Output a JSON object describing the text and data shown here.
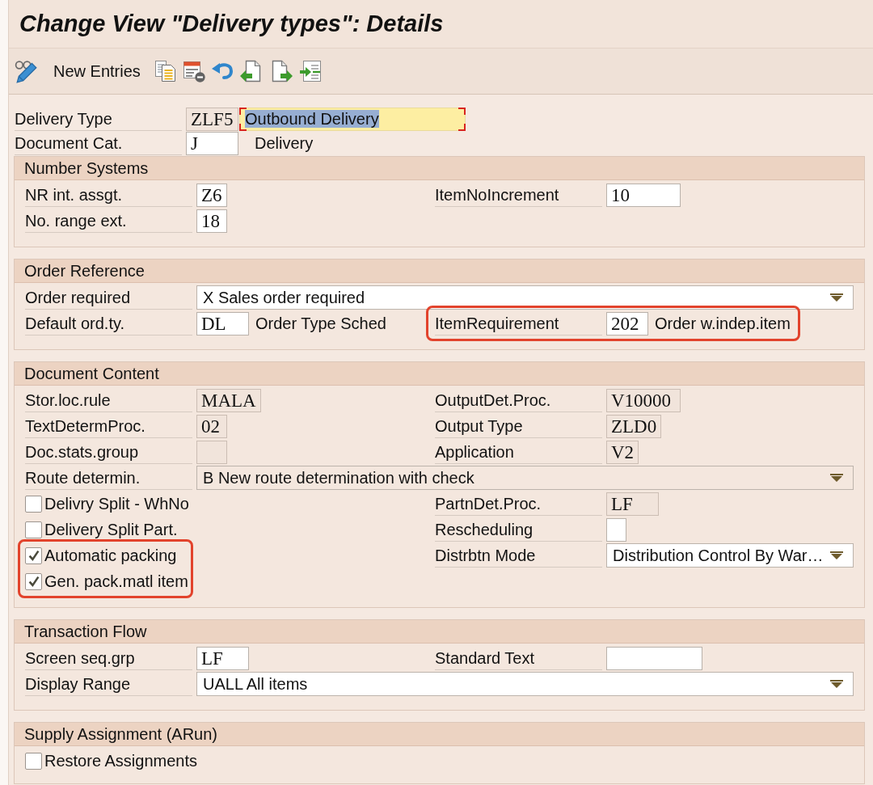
{
  "window": {
    "title": "Change View \"Delivery types\": Details"
  },
  "toolbar": {
    "new_entries": "New Entries"
  },
  "header_fields": [
    {
      "label": "Delivery Type",
      "value": "ZLF5",
      "disabled": true,
      "text_field": {
        "value": "Outbound Delivery",
        "focused": true,
        "text_selected": true
      }
    },
    {
      "label": "Document Cat.",
      "value": "J",
      "disabled": false,
      "description": "Delivery"
    }
  ],
  "sections": [
    {
      "title": "Number Systems",
      "rows": [
        {
          "left": {
            "kind": "field",
            "label": "NR int. assgt.",
            "value": "Z6",
            "disabled": false
          },
          "right": {
            "kind": "field",
            "label": "ItemNoIncrement",
            "value": "10",
            "disabled": false
          }
        },
        {
          "left": {
            "kind": "field",
            "label": "No. range ext.",
            "value": "18",
            "disabled": false
          }
        }
      ]
    },
    {
      "title": "Order Reference",
      "rows": [
        {
          "full": {
            "kind": "dropdown",
            "label": "Order required",
            "value": "X Sales order required",
            "disabled": false
          }
        },
        {
          "left": {
            "kind": "field",
            "label": "Default ord.ty.",
            "value": "DL",
            "disabled": false,
            "description": "Order Type Sched"
          },
          "right": {
            "kind": "field",
            "label": "ItemRequirement",
            "value": "202",
            "disabled": false,
            "description": "Order w.indep.item",
            "highlighted": true
          }
        }
      ]
    },
    {
      "title": "Document Content",
      "rows": [
        {
          "left": {
            "kind": "field",
            "label": "Stor.loc.rule",
            "value": "MALA",
            "disabled": true
          },
          "right": {
            "kind": "field",
            "label": "OutputDet.Proc.",
            "value": "V10000",
            "disabled": true
          }
        },
        {
          "left": {
            "kind": "field",
            "label": "TextDetermProc.",
            "value": "02",
            "disabled": true
          },
          "right": {
            "kind": "field",
            "label": "Output Type",
            "value": "ZLD0",
            "disabled": true
          }
        },
        {
          "left": {
            "kind": "field",
            "label": "Doc.stats.group",
            "disabled": true
          },
          "right": {
            "kind": "field",
            "label": "Application",
            "value": "V2",
            "disabled": true
          }
        },
        {
          "full": {
            "kind": "dropdown",
            "label": "Route determin.",
            "value": "B New route determination with check",
            "disabled": true
          }
        },
        {
          "left": {
            "kind": "checkbox",
            "label": "Delivry Split - WhNo",
            "checked": false
          },
          "right": {
            "kind": "field",
            "label": "PartnDet.Proc.",
            "value": "LF",
            "disabled": true
          }
        },
        {
          "left": {
            "kind": "checkbox",
            "label": "Delivery Split Part.",
            "checked": false
          },
          "right": {
            "kind": "field",
            "label": "Rescheduling",
            "disabled": false
          }
        },
        {
          "left": {
            "kind": "checkbox_group",
            "highlighted": true,
            "items": [
              {
                "label": "Automatic packing",
                "checked": true
              },
              {
                "label": "Gen. pack.matl item",
                "checked": true
              }
            ]
          },
          "right": {
            "kind": "dropdown",
            "label": "Distrbtn Mode",
            "value": "Distribution Control By War…",
            "disabled": false
          }
        }
      ]
    },
    {
      "title": "Transaction Flow",
      "rows": [
        {
          "left": {
            "kind": "field",
            "label": "Screen seq.grp",
            "value": "LF",
            "disabled": false
          },
          "right": {
            "kind": "field",
            "label": "Standard Text",
            "disabled": false
          }
        },
        {
          "full": {
            "kind": "dropdown",
            "label": "Display Range",
            "value": "UALL All items",
            "disabled": false
          }
        }
      ]
    },
    {
      "title": "Supply Assignment (ARun)",
      "rows": [
        {
          "left": {
            "kind": "checkbox",
            "label": "Restore Assignments",
            "checked": false
          }
        }
      ]
    }
  ]
}
